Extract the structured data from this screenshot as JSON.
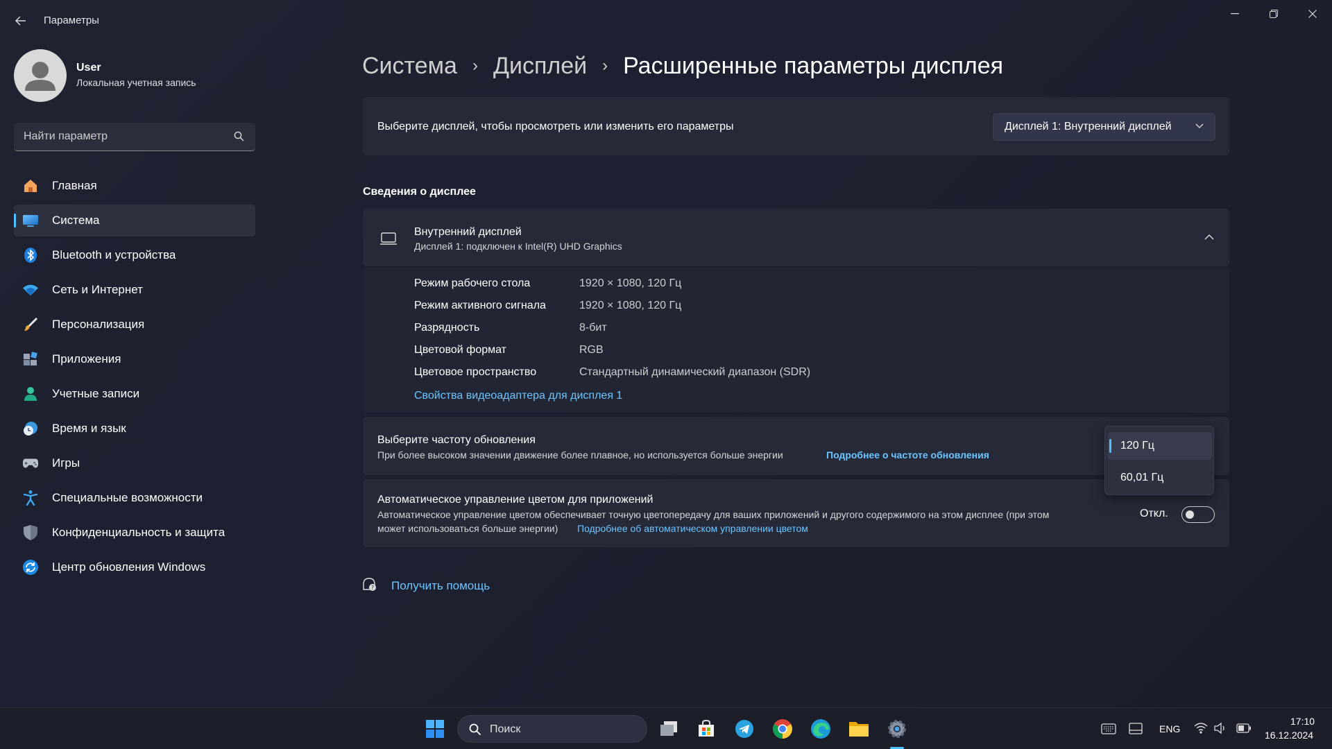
{
  "window": {
    "app_title": "Параметры",
    "controls": [
      "minimize-icon",
      "maximize-icon",
      "close-icon"
    ]
  },
  "user": {
    "name": "User",
    "account_type": "Локальная учетная запись"
  },
  "search": {
    "placeholder": "Найти параметр"
  },
  "sidebar": {
    "items": [
      {
        "label": "Главная",
        "icon": "home-icon",
        "active": false
      },
      {
        "label": "Система",
        "icon": "system-icon",
        "active": true
      },
      {
        "label": "Bluetooth и устройства",
        "icon": "bluetooth-icon",
        "active": false
      },
      {
        "label": "Сеть и Интернет",
        "icon": "wifi-icon",
        "active": false
      },
      {
        "label": "Персонализация",
        "icon": "brush-icon",
        "active": false
      },
      {
        "label": "Приложения",
        "icon": "apps-icon",
        "active": false
      },
      {
        "label": "Учетные записи",
        "icon": "account-icon",
        "active": false
      },
      {
        "label": "Время и язык",
        "icon": "time-language-icon",
        "active": false
      },
      {
        "label": "Игры",
        "icon": "gamepad-icon",
        "active": false
      },
      {
        "label": "Специальные возможности",
        "icon": "accessibility-icon",
        "active": false
      },
      {
        "label": "Конфиденциальность и защита",
        "icon": "shield-icon",
        "active": false
      },
      {
        "label": "Центр обновления Windows",
        "icon": "update-icon",
        "active": false
      }
    ]
  },
  "breadcrumb": {
    "level1": "Система",
    "level2": "Дисплей",
    "current": "Расширенные параметры дисплея"
  },
  "display_select": {
    "prompt": "Выберите дисплей, чтобы просмотреть или изменить его параметры",
    "selected": "Дисплей 1: Внутренний дисплей"
  },
  "info": {
    "section_title": "Сведения о дисплее",
    "display_name": "Внутренний дисплей",
    "display_sub": "Дисплей 1: подключен к Intel(R) UHD Graphics",
    "rows": [
      {
        "key": "Режим рабочего стола",
        "value": "1920 × 1080, 120 Гц"
      },
      {
        "key": "Режим активного сигнала",
        "value": "1920 × 1080, 120 Гц"
      },
      {
        "key": "Разрядность",
        "value": "8-бит"
      },
      {
        "key": "Цветовой формат",
        "value": "RGB"
      },
      {
        "key": "Цветовое пространство",
        "value": "Стандартный динамический диапазон (SDR)"
      }
    ],
    "adapter_link": "Свойства видеоадаптера для дисплея 1"
  },
  "refresh": {
    "title": "Выберите частоту обновления",
    "desc": "При более высоком значении движение более плавное, но используется больше энергии",
    "link": "Подробнее о частоте обновления",
    "options": [
      "120 Гц",
      "60,01 Гц"
    ],
    "selected": "120 Гц"
  },
  "auto_color": {
    "title": "Автоматическое управление цветом для приложений",
    "desc_line1": "Автоматическое управление цветом обеспечивает точную цветопередачу для ваших приложений и другого содержимого на этом дисплее (при этом",
    "desc_line2": "может использоваться больше энергии)",
    "link": "Подробнее об автоматическом управлении цветом",
    "toggle_label": "Откл.",
    "toggle_on": false
  },
  "help": {
    "label": "Получить помощь"
  },
  "taskbar": {
    "search_label": "Поиск",
    "apps": [
      "start-icon",
      "task-view-icon",
      "store-icon",
      "telegram-icon",
      "chrome-icon",
      "edge-icon",
      "file-explorer-icon",
      "settings-icon"
    ],
    "language": "ENG",
    "time": "17:10",
    "date": "16.12.2024"
  },
  "colors": {
    "accent": "#4cc2ff",
    "link": "#6cc4ff",
    "card_bg": "#262a38"
  }
}
